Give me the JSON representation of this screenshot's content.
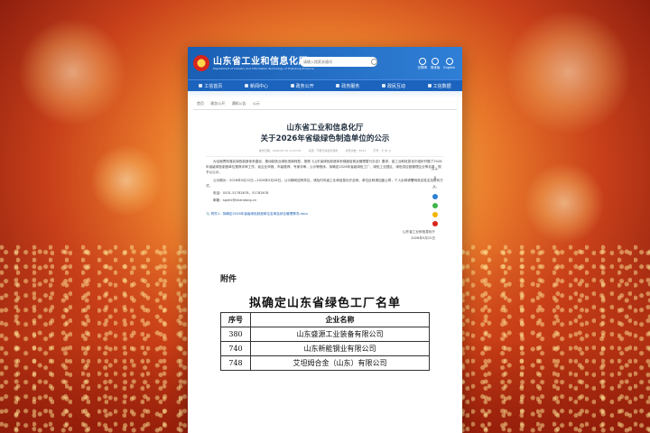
{
  "site": {
    "title": "山东省工业和信息化厅",
    "subtitle": "Department of Industry and Information Technology of Shandong Province",
    "search_placeholder": "请输入搜索关键词",
    "top_links": [
      "无障碍",
      "简体版",
      "English"
    ]
  },
  "nav": [
    "工信首页",
    "新闻中心",
    "政务公开",
    "政务服务",
    "政民互动",
    "工信数据"
  ],
  "breadcrumb": [
    "首页",
    "政务公开",
    "通知公告",
    "公示"
  ],
  "article": {
    "title_line1": "山东省工业和信息化厅",
    "title_line2": "关于2026年省级绿色制造单位的公示",
    "meta": [
      "发布日期：2026-05-22 11:23:41",
      "来源：节能与综合利用处",
      "浏览次数：8133",
      "字号：大 中 小"
    ],
    "paragraphs": [
      "为全面贯彻落实绿色制造体系建设，推动制造业绿色低碳转型，按照《山东省绿色制造体系梯度培育及管理暂行办法》要求，省工业和信息化厅组织开展了2026年省级绿色制造单位推荐评审工作，经企业申报、市级推荐、专家评审、公示等程序，拟确定2026年省级绿色工厂、绿色工业园区、绿色供应链管理企业等名单，现予以公示。",
      "公示期为：2026年5月22日—2026年5月28日。公示期间如有异议，请及时向省工业和信息化厅反映，单位反映请加盖公章，个人反映请署明真实姓名及联系方式。",
      "电话：0531-51782678，51782678",
      "邮箱：sgxtlc@shandong.cn"
    ],
    "attachment": "附件1：拟确定2026年省级绿色制造单位名单及综合管理情况.docx",
    "sign_org": "山东省工业和信息化厅",
    "sign_date": "2026年5月22日",
    "side_tools": [
      "A+",
      "A",
      "A-"
    ]
  },
  "appendix": {
    "label": "附件",
    "title": "拟确定山东省绿色工厂名单",
    "columns": [
      "序号",
      "企业名称"
    ],
    "rows": [
      {
        "no": "380",
        "name": "山东盛源工业装备有限公司"
      },
      {
        "no": "740",
        "name": "山东新能钢业有限公司"
      },
      {
        "no": "748",
        "name": "艾坦姆合金（山东）有限公司"
      }
    ]
  },
  "colors": {
    "brand_blue": "#1a5fb4",
    "background_warm": "#e8772a"
  }
}
